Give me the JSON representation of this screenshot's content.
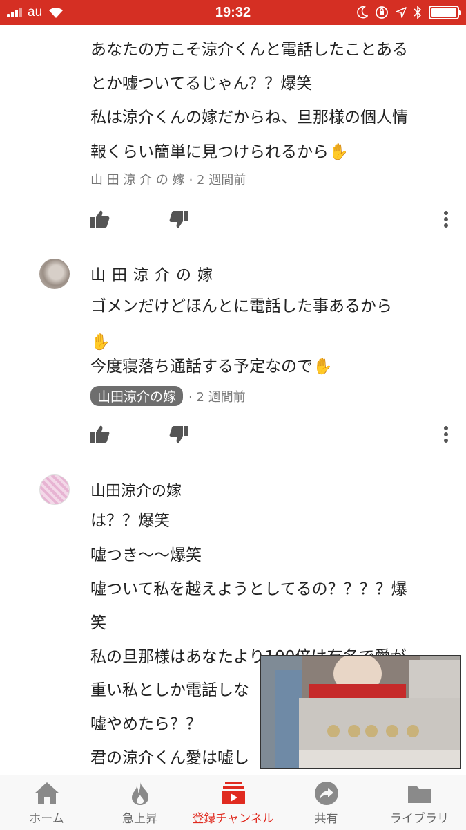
{
  "status_bar": {
    "carrier": "au",
    "time": "19:32"
  },
  "comments": [
    {
      "lines": [
        "あなたの方こそ涼介くんと電話したことある",
        "とか嘘ついてるじゃん？？爆笑",
        "私は涼介くんの嫁だからね、旦那様の個人情",
        "報くらい簡単に見つけられるから✋"
      ],
      "author": "山 田 涼 介 の 嫁",
      "time": "· 2 週間前"
    },
    {
      "author": "山 田 涼 介 の 嫁",
      "lines": [
        " ゴメンだけどほんとに電話した事あるから",
        "✋",
        "今度寝落ち通話する予定なので✋"
      ],
      "chip": "山田涼介の嫁",
      "time": "· 2 週間前"
    },
    {
      "author": "山田涼介の嫁",
      "lines": [
        "は？？爆笑",
        "嘘つき〜〜爆笑",
        "嘘ついて私を越えようとしてるの？？？？爆",
        "笑",
        "私の旦那様はあなたより100倍は有名で愛が",
        "重い私としか電話しな",
        "嘘やめたら？？",
        "君の涼介くん愛は嘘し"
      ]
    }
  ],
  "bottom_nav": [
    {
      "label": "ホーム",
      "icon": "home-icon"
    },
    {
      "label": "急上昇",
      "icon": "trending-flame-icon"
    },
    {
      "label": "登録チャンネル",
      "icon": "subscriptions-icon",
      "active": true
    },
    {
      "label": "共有",
      "icon": "share-icon"
    },
    {
      "label": "ライブラリ",
      "icon": "library-folder-icon"
    }
  ],
  "colors": {
    "brand_red": "#d52f23",
    "active_nav": "#e02b20",
    "icon_gray": "#555555",
    "nav_icon_gray": "#8a8a8a"
  }
}
